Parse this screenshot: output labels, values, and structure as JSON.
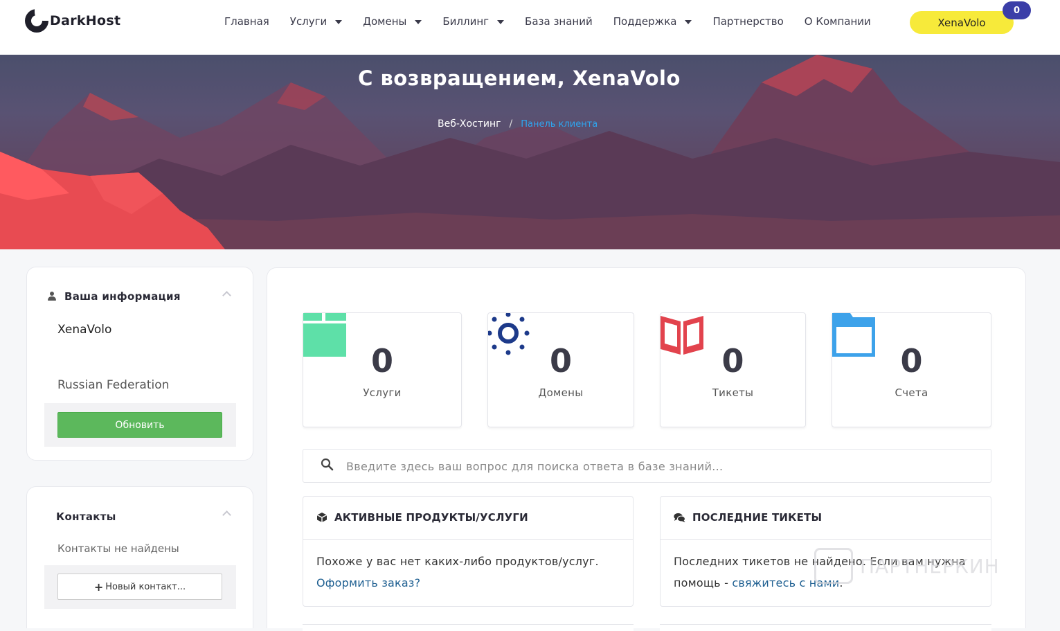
{
  "brand": {
    "name": "DarkHost"
  },
  "nav": {
    "items": [
      {
        "label": "Главная",
        "dropdown": false
      },
      {
        "label": "Услуги",
        "dropdown": true
      },
      {
        "label": "Домены",
        "dropdown": true
      },
      {
        "label": "Биллинг",
        "dropdown": true
      },
      {
        "label": "База знаний",
        "dropdown": false
      },
      {
        "label": "Поддержка",
        "dropdown": true
      },
      {
        "label": "Партнерство",
        "dropdown": false
      },
      {
        "label": "О Компании",
        "dropdown": false
      }
    ],
    "user_label": "XenaVolo",
    "cart_count": "0",
    "colors": {
      "user_button": "#f7ea3a",
      "badge": "#3b3ea8"
    }
  },
  "hero": {
    "title": "С возвращением, XenaVolo",
    "breadcrumb": {
      "home": "Веб-Хостинг",
      "separator": "/",
      "current": "Панель клиента"
    }
  },
  "sidebar": {
    "info": {
      "title": "Ваша информация",
      "name": "XenaVolo",
      "country": "Russian Federation",
      "update_button": "Обновить"
    },
    "contacts": {
      "title": "Контакты",
      "empty_text": "Контакты не найдены",
      "new_button": "Новый контакт..."
    }
  },
  "stats": [
    {
      "value": "0",
      "label": "Услуги",
      "icon": "box-icon",
      "color": "#5ee0a8"
    },
    {
      "value": "0",
      "label": "Домены",
      "icon": "globe-icon",
      "color": "#1d3a8a"
    },
    {
      "value": "0",
      "label": "Тикеты",
      "icon": "book-icon",
      "color": "#e2434d"
    },
    {
      "value": "0",
      "label": "Счета",
      "icon": "folder-icon",
      "color": "#3da2ea"
    }
  ],
  "search": {
    "placeholder": "Введите здесь ваш вопрос для поиска ответа в базе знаний..."
  },
  "panels": {
    "services": {
      "title": "АКТИВНЫЕ ПРОДУКТЫ/УСЛУГИ",
      "body": "Похоже у вас нет каких-либо продуктов/услуг.",
      "link": "Оформить заказ?"
    },
    "tickets": {
      "title": "ПОСЛЕДНИЕ ТИКЕТЫ",
      "body": "Последних тикетов не найдено. Если вам нужна помощь - ",
      "link": "свяжитесь с нами",
      "tail": "."
    }
  },
  "watermark": {
    "text": "ПАРТНЕРКИН"
  }
}
